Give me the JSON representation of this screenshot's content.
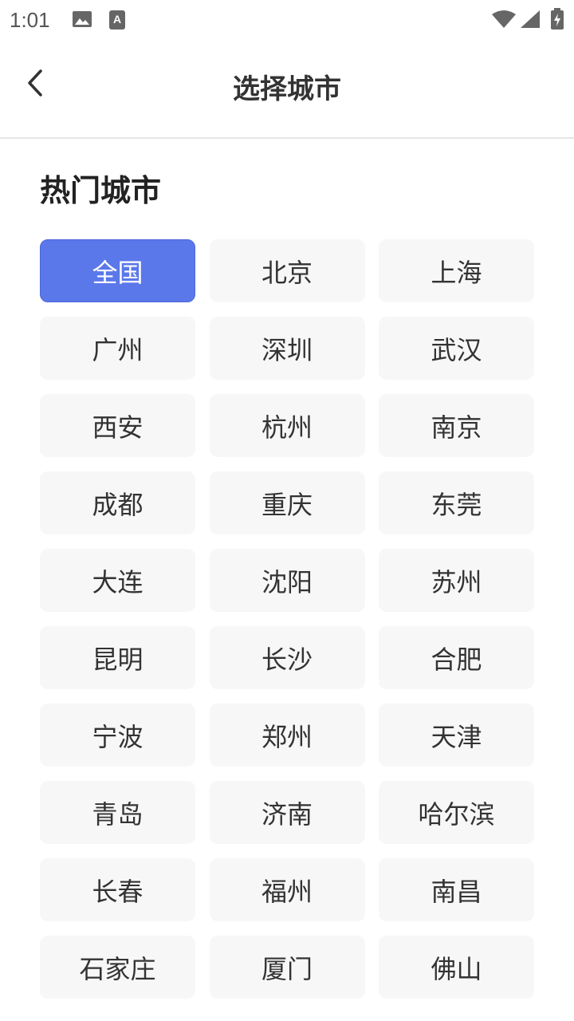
{
  "status_bar": {
    "time": "1:01",
    "left_icons": [
      "image-icon",
      "a-icon"
    ],
    "right_icons": [
      "wifi-icon",
      "signal-icon",
      "battery-icon"
    ]
  },
  "header": {
    "title": "选择城市",
    "back_icon": "back-chevron-icon"
  },
  "section": {
    "title": "热门城市"
  },
  "cities": [
    "全国",
    "北京",
    "上海",
    "广州",
    "深圳",
    "武汉",
    "西安",
    "杭州",
    "南京",
    "成都",
    "重庆",
    "东莞",
    "大连",
    "沈阳",
    "苏州",
    "昆明",
    "长沙",
    "合肥",
    "宁波",
    "郑州",
    "天津",
    "青岛",
    "济南",
    "哈尔滨",
    "长春",
    "福州",
    "南昌",
    "石家庄",
    "厦门",
    "佛山"
  ],
  "selected_city": "全国",
  "colors": {
    "accent": "#5b78ea",
    "chip_bg": "#f7f7f7",
    "text": "#333333"
  }
}
